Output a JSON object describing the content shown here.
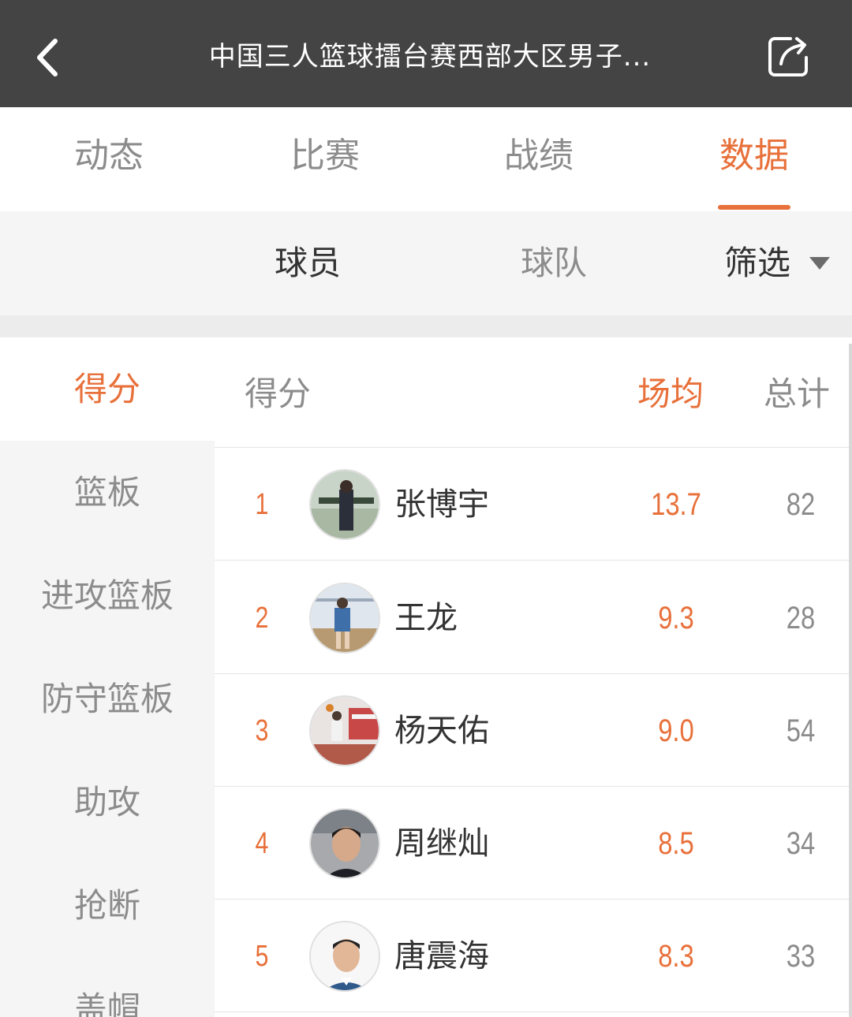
{
  "header": {
    "title": "中国三人篮球擂台赛西部大区男子...",
    "back_icon": "chevron-left-icon",
    "share_icon": "share-icon"
  },
  "main_tabs": [
    {
      "label": "动态",
      "active": false
    },
    {
      "label": "比赛",
      "active": false
    },
    {
      "label": "战绩",
      "active": false
    },
    {
      "label": "数据",
      "active": true
    }
  ],
  "sub_tabs": {
    "players": "球员",
    "teams": "球队",
    "filter": "筛选",
    "filter_icon": "caret-down-icon"
  },
  "categories": [
    {
      "label": "得分",
      "active": true
    },
    {
      "label": "篮板",
      "active": false
    },
    {
      "label": "进攻篮板",
      "active": false
    },
    {
      "label": "防守篮板",
      "active": false
    },
    {
      "label": "助攻",
      "active": false
    },
    {
      "label": "抢断",
      "active": false
    },
    {
      "label": "盖帽",
      "active": false
    }
  ],
  "ranking": {
    "metric": "得分",
    "avg_header": "场均",
    "total_header": "总计",
    "rows": [
      {
        "rank": "1",
        "name": "张博宇",
        "avg": "13.7",
        "total": "82"
      },
      {
        "rank": "2",
        "name": "王龙",
        "avg": "9.3",
        "total": "28"
      },
      {
        "rank": "3",
        "name": "杨天佑",
        "avg": "9.0",
        "total": "54"
      },
      {
        "rank": "4",
        "name": "周继灿",
        "avg": "8.5",
        "total": "34"
      },
      {
        "rank": "5",
        "name": "唐震海",
        "avg": "8.3",
        "total": "33"
      }
    ]
  },
  "colors": {
    "accent": "#e8703a",
    "header_bg": "#444444",
    "muted_text": "#8c8c8c",
    "panel_bg": "#f5f5f5"
  }
}
